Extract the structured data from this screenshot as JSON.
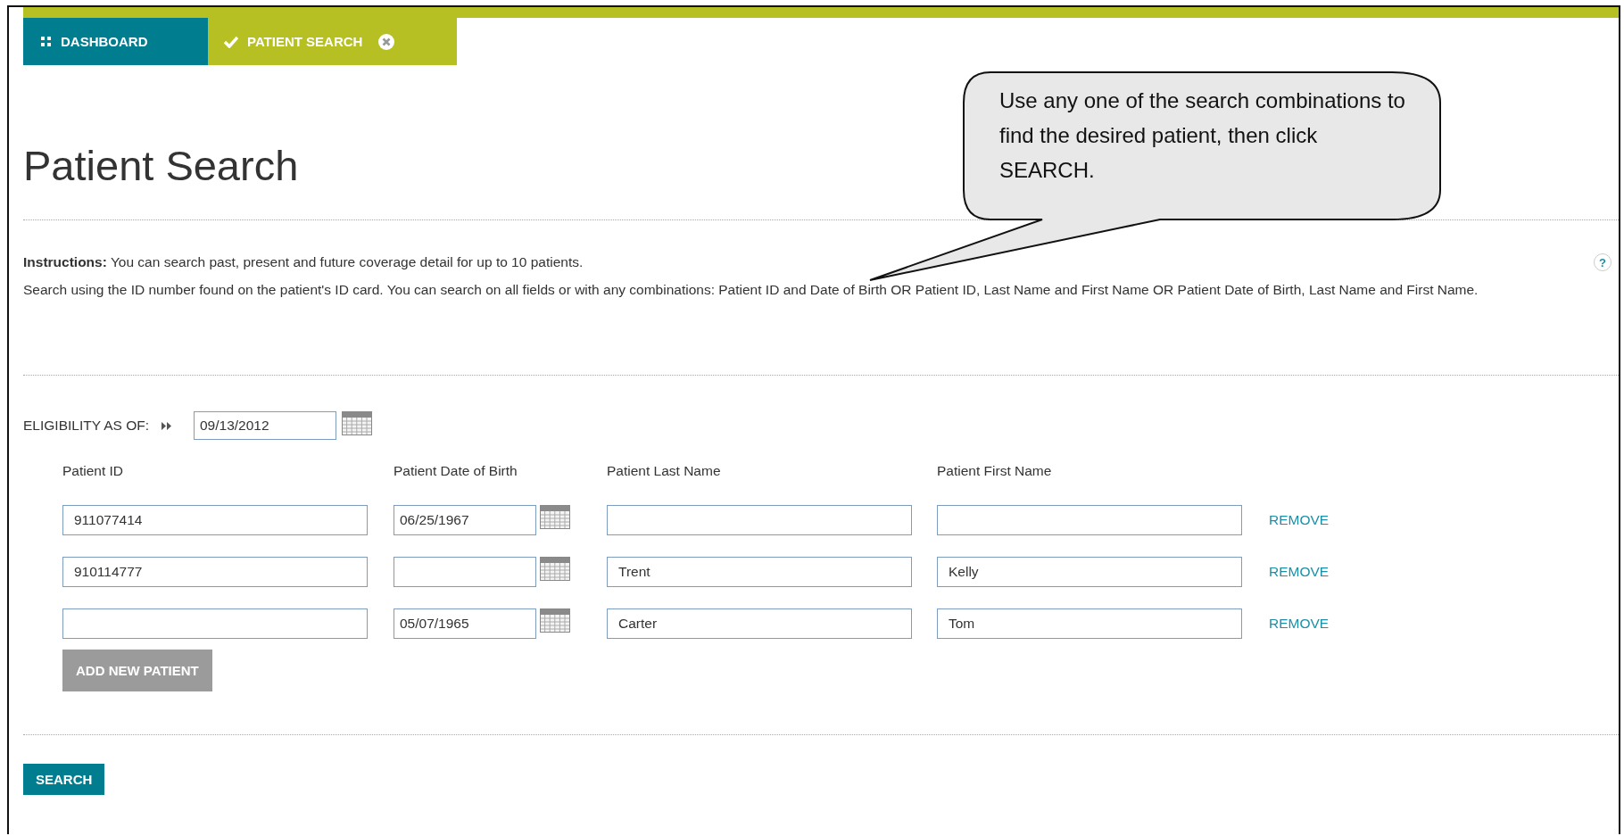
{
  "tabs": [
    {
      "label": "DASHBOARD",
      "kind": "dashboard",
      "selected": false,
      "closable": false
    },
    {
      "label": "PATIENT SEARCH",
      "kind": "page",
      "selected": true,
      "closable": true
    }
  ],
  "page_title": "Patient Search",
  "help": "?",
  "instructions": "**Instructions:** You can search past, present and future coverage detail for up to 10 patients.",
  "search_help": "Search using the ID number found on the patient's ID card. You can search on all fields or with any combinations: Patient ID and Date of Birth OR Patient ID, Last Name and First Name OR Patient Date of Birth, Last Name and First Name.",
  "eligibility": {
    "label": "ELIGIBILITY AS OF:",
    "value": "09/13/2012"
  },
  "patients": {
    "columns": [
      "Patient ID",
      "Patient Date of Birth",
      "Patient Last Name",
      "Patient First Name"
    ],
    "rows": [
      {
        "patient_id": "911077414",
        "date_of_birth": "06/25/1967",
        "last_name": "",
        "first_name": "",
        "action": "REMOVE"
      },
      {
        "patient_id": "910114777",
        "date_of_birth": "",
        "last_name": "Trent",
        "first_name": "Kelly",
        "action": "REMOVE"
      },
      {
        "patient_id": "",
        "date_of_birth": "05/07/1965",
        "last_name": "Carter",
        "first_name": "Tom",
        "action": "REMOVE"
      }
    ]
  },
  "add_button": {
    "label": "ADD NEW PATIENT",
    "disabled": true
  },
  "search_button": {
    "label": "SEARCH",
    "disabled": false
  },
  "callout": "Use any one of the search combinations to find the desired patient, then click SEARCH."
}
